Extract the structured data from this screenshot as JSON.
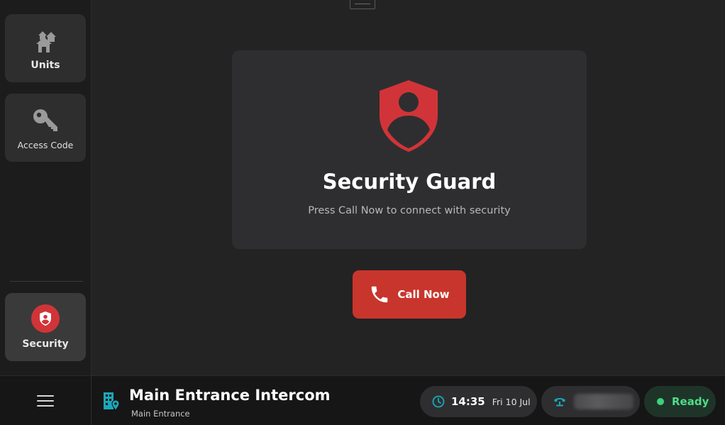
{
  "sidebar": {
    "items": [
      {
        "id": "units",
        "label": "Units",
        "icon": "homes-icon"
      },
      {
        "id": "access-code",
        "label": "Access Code",
        "icon": "key-icon"
      },
      {
        "id": "security",
        "label": "Security",
        "icon": "shield-user-icon",
        "active": true
      }
    ]
  },
  "card": {
    "title": "Security Guard",
    "subtitle": "Press Call Now to connect with security",
    "icon": "shield-user-icon"
  },
  "call_button": {
    "label": "Call Now",
    "icon": "phone-icon"
  },
  "footer": {
    "menu_icon": "hamburger-icon",
    "location_icon": "building-location-icon",
    "title": "Main Entrance Intercom",
    "subtitle": "Main Entrance",
    "time": "14:35",
    "date": "Fri 10 Jul",
    "phone_icon": "phone-handset-icon",
    "status": "Ready"
  },
  "colors": {
    "accent_red": "#d13438",
    "call_red": "#c8352c",
    "ready_green": "#3ed17a",
    "teal_icon": "#1aa8b8",
    "background": "#232323",
    "card": "#2e2e30"
  }
}
